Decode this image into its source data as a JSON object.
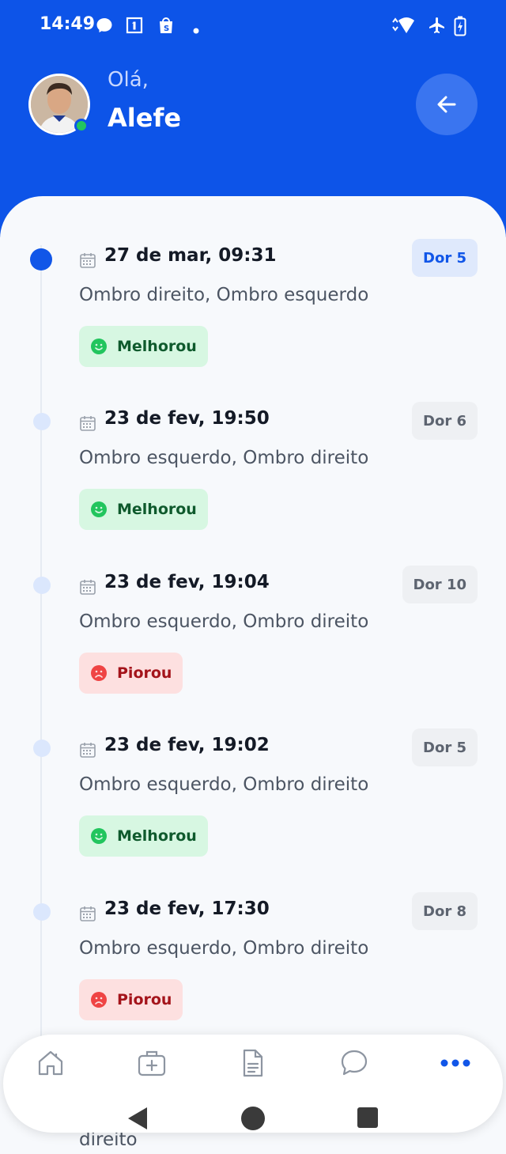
{
  "status_bar": {
    "time": "14:49"
  },
  "header": {
    "greeting": "Olá,",
    "name": "Alefe"
  },
  "entries": [
    {
      "date": "27 de mar, 09:31",
      "pain": "Dor 5",
      "areas": "Ombro direito, Ombro esquerdo",
      "status": "Melhorou"
    },
    {
      "date": "23 de fev, 19:50",
      "pain": "Dor 6",
      "areas": "Ombro esquerdo, Ombro direito",
      "status": "Melhorou"
    },
    {
      "date": "23 de fev, 19:04",
      "pain": "Dor 10",
      "areas": "Ombro esquerdo, Ombro direito",
      "status": "Piorou"
    },
    {
      "date": "23 de fev, 19:02",
      "pain": "Dor 5",
      "areas": "Ombro esquerdo, Ombro direito",
      "status": "Melhorou"
    },
    {
      "date": "23 de fev, 17:30",
      "pain": "Dor 8",
      "areas": "Ombro esquerdo, Ombro direito",
      "status": "Piorou"
    }
  ],
  "partial_text": "direito",
  "colors": {
    "primary": "#0d54e8",
    "good_bg": "#d7f7e2",
    "bad_bg": "#fde0e0"
  },
  "nav": {
    "icons": [
      "home-icon",
      "medical-case-icon",
      "document-icon",
      "chat-icon",
      "more-icon"
    ]
  }
}
